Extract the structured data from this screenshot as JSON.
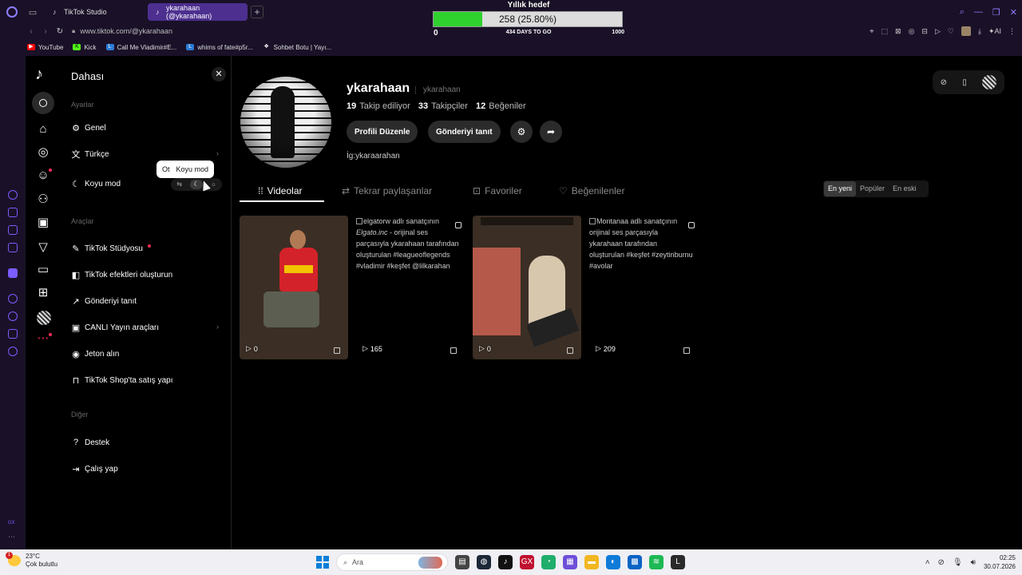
{
  "browser": {
    "tabs": [
      {
        "title": "TikTok Studio",
        "active": false
      },
      {
        "title": "ykarahaan (@ykarahaan)",
        "active": true
      }
    ],
    "url": "www.tiktok.com/@ykarahaan",
    "bookmarks": [
      "YouTube",
      "Kick",
      "Call Me Vladimir#E...",
      "whims of fate#p5r...",
      "Sohbet Botu | Yayı..."
    ],
    "bookmark_colors": {
      "YouTube": "#ff0000",
      "Kick": "#53fc18",
      "generic": "#2b7bd6"
    }
  },
  "goal": {
    "title": "Yıllık hedef",
    "label": "258 (25.80%)",
    "current": 258,
    "target": 1000,
    "fill_fraction": 0.258,
    "min": "0",
    "max": "1000",
    "days": "434 DAYS TO GO",
    "fill_color": "#2fd12f"
  },
  "more_panel": {
    "title": "Dahası",
    "section_settings": "Ayarlar",
    "general": "Genel",
    "language": "Türkçe",
    "dark_mode": "Koyu mod",
    "section_tools": "Araçlar",
    "studio": "TikTok Stüdyosu",
    "effects": "TikTok efektleri oluşturun",
    "promote": "Gönderiyi tanıt",
    "live_tools": "CANLI Yayın araçları",
    "coins": "Jeton alın",
    "shop": "TikTok Shop'ta satış yapı",
    "section_other": "Diğer",
    "support": "Destek",
    "logout": "Çalış yap",
    "tooltip_left": "Ot",
    "tooltip_right": "Koyu mod"
  },
  "profile": {
    "username": "ykarahaan",
    "handle": "ykarahaan",
    "following_count": "19",
    "following_label": "Takip ediliyor",
    "followers_count": "33",
    "followers_label": "Takipçiler",
    "likes_count": "12",
    "likes_label": "Beğeniler",
    "edit_button": "Profili Düzenle",
    "promote_button": "Gönderiyi tanıt",
    "bio": "İg:ykaraarahan"
  },
  "content_tabs": [
    "Videolar",
    "Tekrar paylaşanlar",
    "Favoriler",
    "Beğenilenler"
  ],
  "sort": [
    "En yeni",
    "Popüler",
    "En eski"
  ],
  "sort_active": "En yeni",
  "videos": [
    {
      "views": "0",
      "alt": ""
    },
    {
      "views": "165",
      "alt_lead": "elgatorw adlı sanatçının",
      "alt_brand": "Elgato.inc",
      "alt_rest": " - orijinal ses parçasıyla ykarahaan tarafından oluşturulan #leagueoflegends #vladimir #keşfet @lilkarahan"
    },
    {
      "views": "0",
      "alt": ""
    },
    {
      "views": "209",
      "alt_lead": "Montanaa adlı sanatçının",
      "alt_rest": " orijinal ses parçasıyla ykarahaan tarafından oluşturulan #keşfet #zeytinburnu #avolar"
    }
  ],
  "taskbar": {
    "temp": "23°C",
    "weather": "Çok bulutlu",
    "weather_badge": "1",
    "search": "Ara",
    "time": "02:25",
    "date": "30.07.2026"
  },
  "gx_label": "GX",
  "icons": {
    "close": "✕",
    "chevron": "›",
    "play": "▷",
    "settings": "gear-icon",
    "share": "share-arrow-icon"
  }
}
